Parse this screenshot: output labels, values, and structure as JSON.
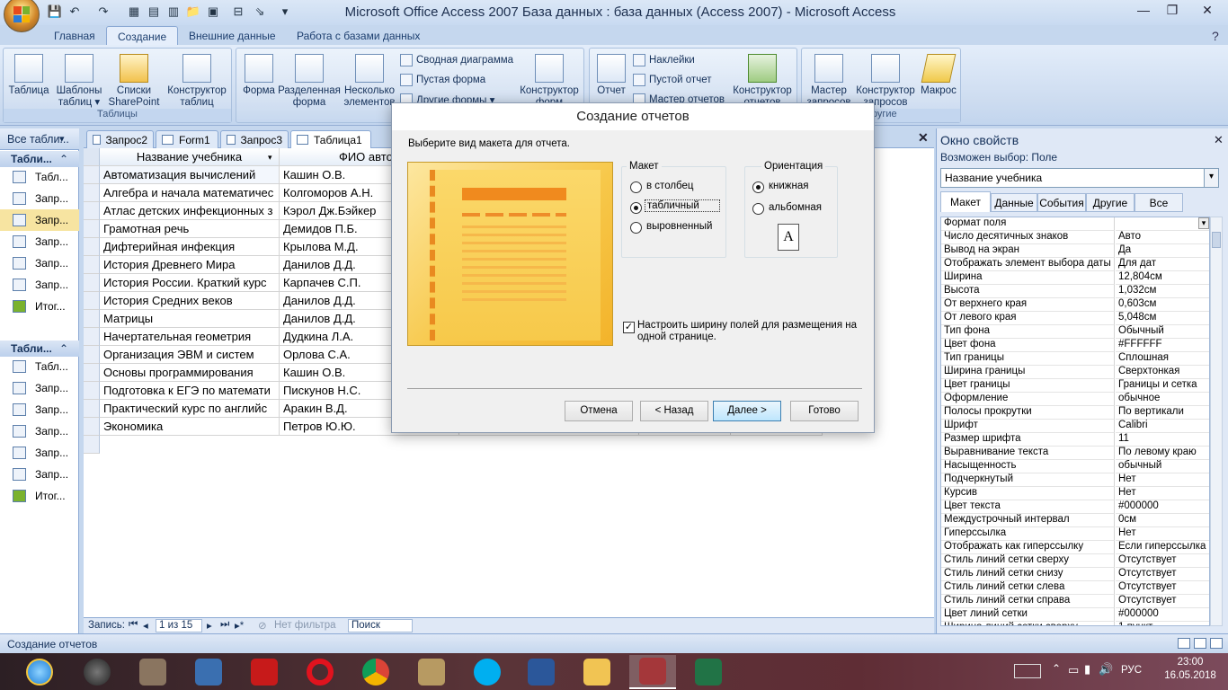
{
  "app": {
    "title": "Microsoft Office Access 2007 База данных : база данных (Access 2007) - Microsoft Access"
  },
  "ribbon_tabs": [
    "Главная",
    "Создание",
    "Внешние данные",
    "Работа с базами данных"
  ],
  "ribbon": {
    "tables": {
      "title": "Таблицы",
      "table": "Таблица",
      "templates": "Шаблоны таблиц ▾",
      "sharepoint": "Списки SharePoint ▾",
      "designer": "Конструктор таблиц"
    },
    "forms": {
      "form": "Форма",
      "split": "Разделенная форма",
      "multi": "Несколько элементов",
      "pivot": "Сводная диаграмма",
      "blank": "Пустая форма",
      "other": "Другие формы ▾",
      "designer": "Конструктор форм"
    },
    "reports": {
      "report": "Отчет",
      "labels": "Наклейки",
      "blank": "Пустой отчет",
      "wizard": "Мастер отчетов",
      "designer": "Конструктор отчетов"
    },
    "other": {
      "title": "Другие",
      "qwizard": "Мастер запросов",
      "qdesigner": "Конструктор запросов",
      "macro": "Макрос"
    }
  },
  "nav": {
    "header": "Все табли...",
    "sections": [
      {
        "label": "Табли...",
        "items": [
          "Табл...",
          "Запр...",
          "Запр...",
          "Запр...",
          "Запр...",
          "Запр...",
          "Итог..."
        ]
      },
      {
        "label": "Табли...",
        "items": [
          "Табл...",
          "Запр...",
          "Запр...",
          "Запр...",
          "Запр...",
          "Запр...",
          "Итог..."
        ]
      }
    ]
  },
  "doc_tabs": [
    "Запрос2",
    "Form1",
    "Запрос3",
    "Таблица1"
  ],
  "table": {
    "headers": [
      "Название учебника",
      "ФИО автор"
    ],
    "rows": [
      [
        "Автоматизация вычислений",
        "Кашин О.В."
      ],
      [
        "Алгебра и начала математичес",
        "Колгоморов А.Н."
      ],
      [
        "Атлас детских инфекционных з",
        "Кэрол Дж.Бэйкер"
      ],
      [
        "Грамотная речь",
        "Демидов П.Б."
      ],
      [
        "Дифтерийная инфекция",
        "Крылова М.Д."
      ],
      [
        "История Древнего Мира",
        "Данилов Д.Д."
      ],
      [
        "История России. Краткий курс",
        "Карпачев С.П."
      ],
      [
        "История Средних веков",
        "Данилов Д.Д."
      ],
      [
        "Матрицы",
        "Данилов Д.Д."
      ],
      [
        "Начертательная геометрия",
        "Дудкина Л.А."
      ],
      [
        "Организация ЭВМ и систем",
        "Орлова С.А."
      ],
      [
        "Основы программирования",
        "Кашин О.В."
      ],
      [
        "Подготовка к ЕГЭ по математи",
        "Пискунов Н.С."
      ],
      [
        "Практический курс по английс",
        "Аракин В.Д."
      ],
      [
        "Экономика",
        "Петров Ю.Ю."
      ]
    ]
  },
  "record_nav": {
    "label": "Запись:",
    "position": "1 из 15",
    "filter": "Нет фильтра",
    "search": "Поиск"
  },
  "props": {
    "title": "Окно свойств",
    "subtitle": "Возможен выбор:  Поле",
    "combo": "Название учебника",
    "tabs": [
      "Макет",
      "Данные",
      "События",
      "Другие",
      "Все"
    ],
    "rows": [
      [
        "Формат поля",
        ""
      ],
      [
        "Число десятичных знаков",
        "Авто"
      ],
      [
        "Вывод на экран",
        "Да"
      ],
      [
        "Отображать элемент выбора даты",
        "Для дат"
      ],
      [
        "Ширина",
        "12,804см"
      ],
      [
        "Высота",
        "1,032см"
      ],
      [
        "От верхнего края",
        "0,603см"
      ],
      [
        "От левого края",
        "5,048см"
      ],
      [
        "Тип фона",
        "Обычный"
      ],
      [
        "Цвет фона",
        "#FFFFFF"
      ],
      [
        "Тип границы",
        "Сплошная"
      ],
      [
        "Ширина границы",
        "Сверхтонкая"
      ],
      [
        "Цвет границы",
        "Границы и сетка"
      ],
      [
        "Оформление",
        "обычное"
      ],
      [
        "Полосы прокрутки",
        "По вертикали"
      ],
      [
        "Шрифт",
        "Calibri"
      ],
      [
        "Размер шрифта",
        "11"
      ],
      [
        "Выравнивание текста",
        "По левому краю"
      ],
      [
        "Насыщенность",
        "обычный"
      ],
      [
        "Подчеркнутый",
        "Нет"
      ],
      [
        "Курсив",
        "Нет"
      ],
      [
        "Цвет текста",
        "#000000"
      ],
      [
        "Междустрочный интервал",
        "0см"
      ],
      [
        "Гиперссылка",
        "Нет"
      ],
      [
        "Отображать как гиперссылку",
        "Если гиперссылка"
      ],
      [
        "Стиль линий сетки сверху",
        "Отсутствует"
      ],
      [
        "Стиль линий сетки снизу",
        "Отсутствует"
      ],
      [
        "Стиль линий сетки слева",
        "Отсутствует"
      ],
      [
        "Стиль линий сетки справа",
        "Отсутствует"
      ],
      [
        "Цвет линий сетки",
        "#000000"
      ],
      [
        "Ширина линий сетки сверху",
        "1 пункт"
      ]
    ]
  },
  "status": "Создание отчетов",
  "dialog": {
    "title": "Создание отчетов",
    "prompt": "Выберите вид макета для отчета.",
    "layout_legend": "Макет",
    "layouts": [
      "в столбец",
      "табличный",
      "выровненный"
    ],
    "orientation_legend": "Ориентация",
    "orientations": [
      "книжная",
      "альбомная"
    ],
    "checkbox": "Настроить ширину полей для размещения на одной странице.",
    "buttons": {
      "cancel": "Отмена",
      "back": "< Назад",
      "next": "Далее >",
      "finish": "Готово"
    }
  },
  "tray": {
    "lang": "РУС",
    "time": "23:00",
    "date": "16.05.2018"
  }
}
